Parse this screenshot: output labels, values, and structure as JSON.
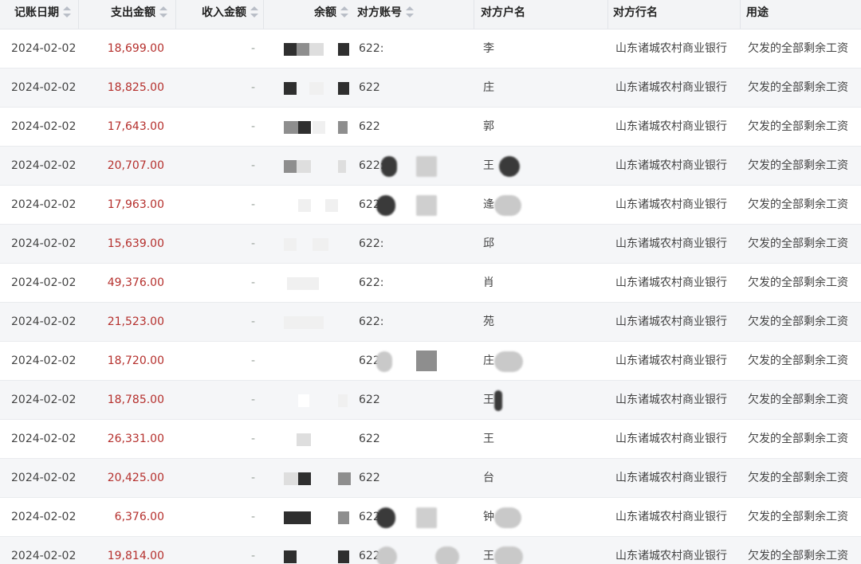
{
  "columns": {
    "date": "记账日期",
    "out": "支出金额",
    "in": "收入金额",
    "balance": "余额",
    "account": "对方账号",
    "name": "对方户名",
    "bank": "对方行名",
    "purpose": "用途"
  },
  "rows": [
    {
      "date": "2024-02-02",
      "out": "18,699.00",
      "in": "-",
      "account": "622:",
      "name": "李",
      "bank": "山东诸城农村商业银行",
      "purpose": "欠发的全部剩余工资"
    },
    {
      "date": "2024-02-02",
      "out": "18,825.00",
      "in": "-",
      "account": "622",
      "name": "庄",
      "bank": "山东诸城农村商业银行",
      "purpose": "欠发的全部剩余工资"
    },
    {
      "date": "2024-02-02",
      "out": "17,643.00",
      "in": "-",
      "account": "622",
      "name": "郭",
      "bank": "山东诸城农村商业银行",
      "purpose": "欠发的全部剩余工资"
    },
    {
      "date": "2024-02-02",
      "out": "20,707.00",
      "in": "-",
      "account": "622:",
      "name": "王",
      "bank": "山东诸城农村商业银行",
      "purpose": "欠发的全部剩余工资"
    },
    {
      "date": "2024-02-02",
      "out": "17,963.00",
      "in": "-",
      "account": "622",
      "name": "逄",
      "bank": "山东诸城农村商业银行",
      "purpose": "欠发的全部剩余工资"
    },
    {
      "date": "2024-02-02",
      "out": "15,639.00",
      "in": "-",
      "account": "622:",
      "name": "邱",
      "bank": "山东诸城农村商业银行",
      "purpose": "欠发的全部剩余工资"
    },
    {
      "date": "2024-02-02",
      "out": "49,376.00",
      "in": "-",
      "account": "622:",
      "name": "肖",
      "bank": "山东诸城农村商业银行",
      "purpose": "欠发的全部剩余工资"
    },
    {
      "date": "2024-02-02",
      "out": "21,523.00",
      "in": "-",
      "account": "622:",
      "name": "苑",
      "bank": "山东诸城农村商业银行",
      "purpose": "欠发的全部剩余工资"
    },
    {
      "date": "2024-02-02",
      "out": "18,720.00",
      "in": "-",
      "account": "622",
      "name": "庄",
      "bank": "山东诸城农村商业银行",
      "purpose": "欠发的全部剩余工资"
    },
    {
      "date": "2024-02-02",
      "out": "18,785.00",
      "in": "-",
      "account": "622",
      "name": "王",
      "bank": "山东诸城农村商业银行",
      "purpose": "欠发的全部剩余工资"
    },
    {
      "date": "2024-02-02",
      "out": "26,331.00",
      "in": "-",
      "account": "622",
      "name": "王",
      "bank": "山东诸城农村商业银行",
      "purpose": "欠发的全部剩余工资"
    },
    {
      "date": "2024-02-02",
      "out": "20,425.00",
      "in": "-",
      "account": "622",
      "name": "台",
      "bank": "山东诸城农村商业银行",
      "purpose": "欠发的全部剩余工资"
    },
    {
      "date": "2024-02-02",
      "out": "6,376.00",
      "in": "-",
      "account": "622",
      "name": "钟",
      "bank": "山东诸城农村商业银行",
      "purpose": "欠发的全部剩余工资"
    },
    {
      "date": "2024-02-02",
      "out": "19,814.00",
      "in": "-",
      "account": "622",
      "name": "王",
      "bank": "山东诸城农村商业银行",
      "purpose": "欠发的全部剩余工资"
    }
  ],
  "icons": {
    "sort": "sort-arrows-icon"
  },
  "colors": {
    "out_amount": "#b5302d",
    "in_amount": "#9aa29b",
    "header_bg": "#f3f4f6",
    "alt_row": "#f5f6f8"
  }
}
